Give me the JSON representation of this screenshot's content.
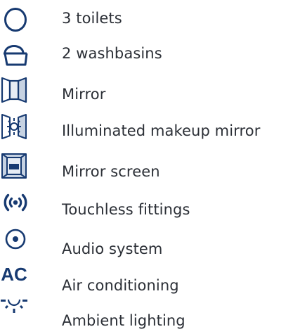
{
  "features": {
    "items": [
      {
        "label": "3 toilets",
        "icon": "toilet-icon"
      },
      {
        "label": "2 washbasins",
        "icon": "washbasin-icon"
      },
      {
        "label": "Mirror",
        "icon": "mirror-icon"
      },
      {
        "label": "Illuminated makeup mirror",
        "icon": "illuminated-mirror-icon"
      },
      {
        "label": "Mirror screen",
        "icon": "mirror-screen-icon"
      },
      {
        "label": "Touchless fittings",
        "icon": "touchless-icon"
      },
      {
        "label": "Audio system",
        "icon": "audio-icon"
      },
      {
        "label": "Air conditioning",
        "icon": "air-conditioning-icon"
      },
      {
        "label": "Ambient lighting",
        "icon": "ambient-lighting-icon"
      }
    ],
    "ac_glyph": "AC"
  },
  "colors": {
    "icon_navy": "#173a71",
    "icon_blue": "#2b5c9e",
    "icon_light": "#d9e2ee",
    "text": "#2b2f36"
  }
}
